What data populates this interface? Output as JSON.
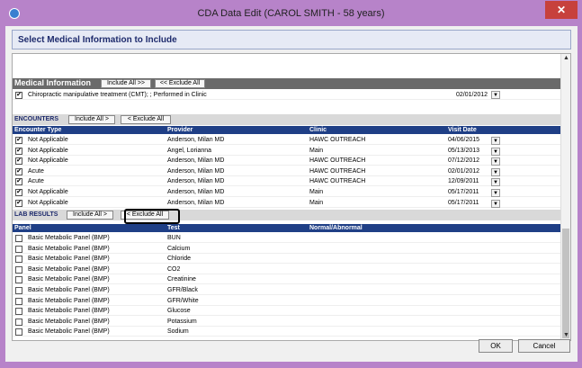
{
  "window": {
    "title": "CDA Data Edit (CAROL SMITH  - 58 years)",
    "close_glyph": "✕"
  },
  "header": {
    "title": "Select Medical Information to Include"
  },
  "medical": {
    "label": "Medical Information",
    "include_all": "Include All >>",
    "exclude_all": "<< Exclude All",
    "row": {
      "text": "Chiropractic manipulative treatment (CMT); ; Performed in Clinic",
      "date": "02/01/2012"
    }
  },
  "encounters": {
    "label": "ENCOUNTERS",
    "include_all": "Include All >",
    "exclude_all": "< Exclude All",
    "columns": [
      "Encounter Type",
      "Provider",
      "Clinic",
      "Visit Date"
    ],
    "rows": [
      {
        "type": "Not Applicable",
        "provider": "Anderson, Milan MD",
        "clinic": "HAWC OUTREACH",
        "date": "04/06/2015"
      },
      {
        "type": "Not Applicable",
        "provider": "Angel, Lorianna",
        "clinic": "Main",
        "date": "05/13/2013"
      },
      {
        "type": "Not Applicable",
        "provider": "Anderson, Milan MD",
        "clinic": "HAWC OUTREACH",
        "date": "07/12/2012"
      },
      {
        "type": "Acute",
        "provider": "Anderson, Milan MD",
        "clinic": "HAWC OUTREACH",
        "date": "02/01/2012"
      },
      {
        "type": "Acute",
        "provider": "Anderson, Milan MD",
        "clinic": "HAWC OUTREACH",
        "date": "12/09/2011"
      },
      {
        "type": "Not Applicable",
        "provider": "Anderson, Milan MD",
        "clinic": "Main",
        "date": "05/17/2011"
      },
      {
        "type": "Not Applicable",
        "provider": "Anderson, Milan MD",
        "clinic": "Main",
        "date": "05/17/2011"
      }
    ]
  },
  "lab": {
    "label": "LAB RESULTS",
    "include_all": "Include All >",
    "exclude_all": "< Exclude All",
    "columns": [
      "Panel",
      "Test",
      "Normal/Abnormal"
    ],
    "rows": [
      {
        "panel": "Basic Metabolic Panel (BMP)",
        "test": "BUN"
      },
      {
        "panel": "Basic Metabolic Panel (BMP)",
        "test": "Calcium"
      },
      {
        "panel": "Basic Metabolic Panel (BMP)",
        "test": "Chloride"
      },
      {
        "panel": "Basic Metabolic Panel (BMP)",
        "test": "CO2"
      },
      {
        "panel": "Basic Metabolic Panel (BMP)",
        "test": "Creatinine"
      },
      {
        "panel": "Basic Metabolic Panel (BMP)",
        "test": "GFR/Black"
      },
      {
        "panel": "Basic Metabolic Panel (BMP)",
        "test": "GFR/White"
      },
      {
        "panel": "Basic Metabolic Panel (BMP)",
        "test": "Glucose"
      },
      {
        "panel": "Basic Metabolic Panel (BMP)",
        "test": "Potassium"
      },
      {
        "panel": "Basic Metabolic Panel (BMP)",
        "test": "Sodium"
      }
    ]
  },
  "footer": {
    "ok": "OK",
    "cancel": "Cancel"
  },
  "icons": {
    "check": "✔",
    "dropdown": "▼",
    "scroll_up": "▲",
    "scroll_down": "▼"
  }
}
